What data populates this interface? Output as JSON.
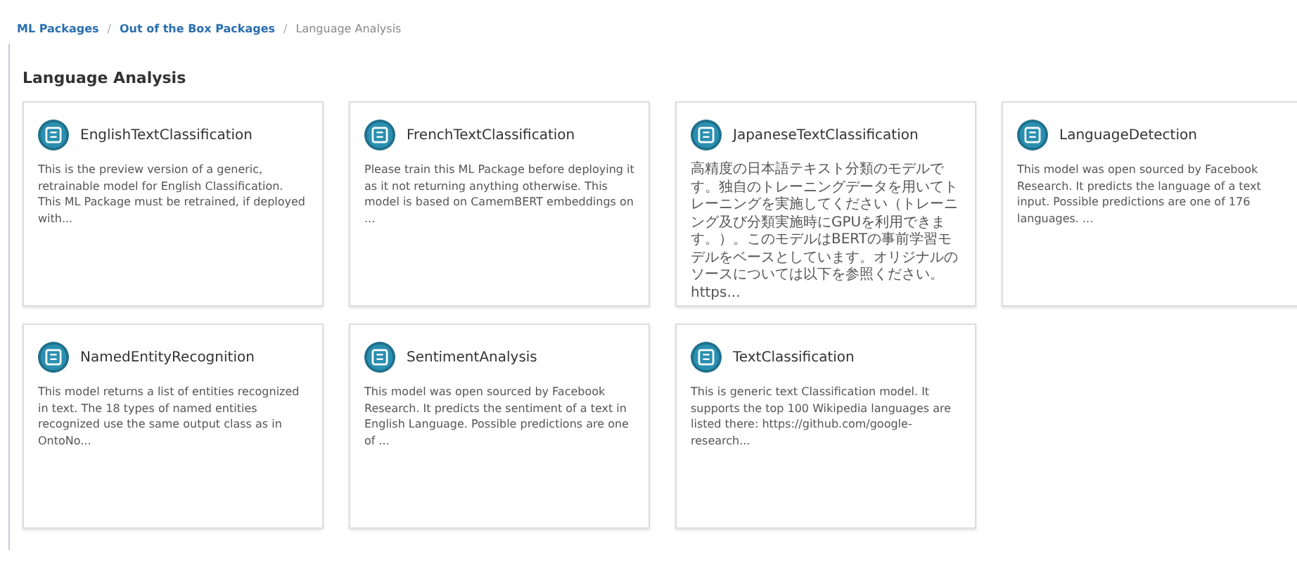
{
  "breadcrumb": [
    {
      "label": "ML Packages",
      "link": true,
      "separator": "/"
    },
    {
      "label": "Out of the Box Packages",
      "link": true,
      "separator": "/"
    },
    {
      "label": "Language Analysis",
      "link": false
    }
  ],
  "heading": "Language Analysis",
  "cards": [
    {
      "title": "EnglishTextClassification",
      "description": "This is the preview version of a generic, retrainable model for English Classification. This ML Package must be retrained, if deployed with..."
    },
    {
      "title": "FrenchTextClassification",
      "description": "Please train this ML Package before deploying it as it not returning anything otherwise. This model is based on CamemBERT embeddings on ..."
    },
    {
      "title": "JapaneseTextClassification",
      "description": "高精度の日本語テキスト分類のモデルです。独自のトレーニングデータを用いてトレーニングを実施してください（トレーニング及び分類実施時にGPUを利用できます。）。このモデルはBERTの事前学習モデルをベースとしています。オリジナルのソースについては以下を参照ください。https..."
    },
    {
      "title": "LanguageDetection",
      "description": "This model was open sourced by Facebook Research. It predicts the language of a text input. Possible predictions are one of 176 languages. ..."
    },
    {
      "title": "NamedEntityRecognition",
      "description": "This model returns a list of entities recognized in text. The 18 types of named entities recognized use the same output class as in OntoNo..."
    },
    {
      "title": "SentimentAnalysis",
      "description": "This model was open sourced by Facebook Research. It predicts the sentiment of a text in English Language. Possible predictions are one of ..."
    },
    {
      "title": "TextClassification",
      "description": "This is generic text Classification model. It supports the top 100 Wikipedia languages are listed there: https://github.com/google-research..."
    }
  ]
}
